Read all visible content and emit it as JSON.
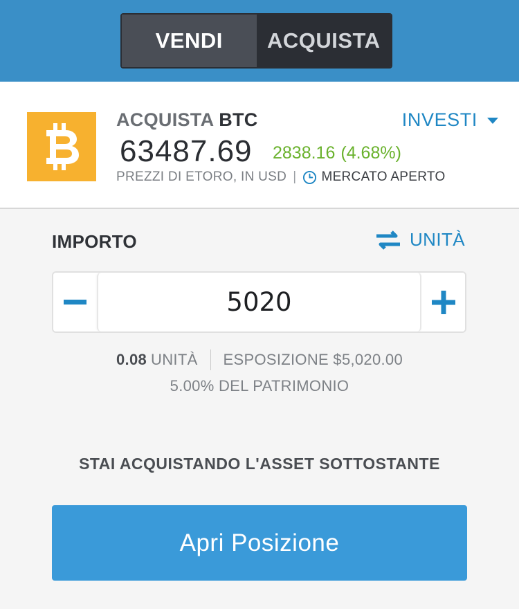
{
  "header": {
    "sell_label": "VENDI",
    "buy_label": "ACQUISTA"
  },
  "asset": {
    "logo_icon": "bitcoin-icon",
    "action_label": "ACQUISTA",
    "symbol": "BTC",
    "price": "63487.69",
    "change_value": "2838.16",
    "change_percent": "(4.68%)",
    "price_source": "PREZZI DI ETORO, IN USD",
    "separator": "|",
    "market_status": "MERCATO APERTO",
    "mode_label": "INVESTI",
    "colors": {
      "logo": "#f7b12f",
      "positive": "#6ab22d",
      "accent": "#1f87c4"
    }
  },
  "amount": {
    "label": "IMPORTO",
    "units_toggle_label": "UNITÀ",
    "value": "5020"
  },
  "stats": {
    "units_value": "0.08",
    "units_label": "UNITÀ",
    "exposure": "ESPOSIZIONE $5,020.00",
    "equity": "5.00% DEL PATRIMONIO"
  },
  "notice": "STAI ACQUISTANDO L'ASSET SOTTOSTANTE",
  "open_button_label": "Apri Posizione"
}
